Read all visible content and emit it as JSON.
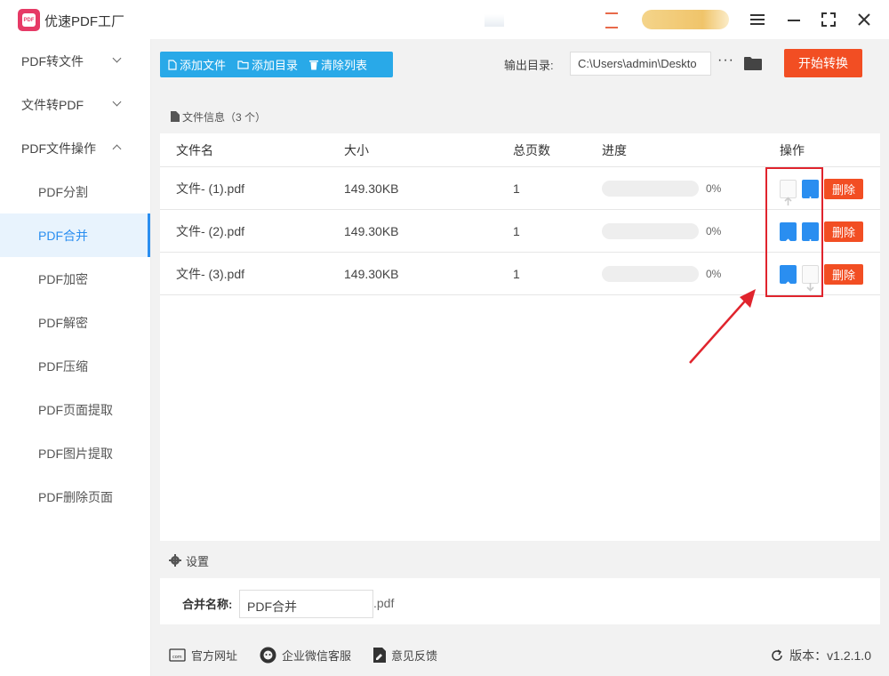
{
  "app": {
    "title": "优速PDF工厂",
    "logo_text": "PDF"
  },
  "sidebar": {
    "groups": [
      {
        "label": "PDF转文件",
        "expanded": false
      },
      {
        "label": "文件转PDF",
        "expanded": false
      },
      {
        "label": "PDF文件操作",
        "expanded": true
      }
    ],
    "items": [
      "PDF分割",
      "PDF合并",
      "PDF加密",
      "PDF解密",
      "PDF压缩",
      "PDF页面提取",
      "PDF图片提取",
      "PDF删除页面"
    ],
    "active_item": "PDF合并"
  },
  "toolbar": {
    "add_file": "添加文件",
    "add_dir": "添加目录",
    "clear_list": "清除列表",
    "output_label": "输出目录:",
    "output_path": "C:\\Users\\admin\\Deskto",
    "more": "···",
    "start": "开始转换"
  },
  "file_panel": {
    "title": "文件信息（3 个）",
    "columns": [
      "文件名",
      "大小",
      "总页数",
      "进度",
      "操作"
    ],
    "rows": [
      {
        "name": "文件- (1).pdf",
        "size": "149.30KB",
        "pages": "1",
        "progress_text": "0%",
        "progress": 0,
        "up_enabled": false,
        "down_enabled": true,
        "delete": "删除"
      },
      {
        "name": "文件- (2).pdf",
        "size": "149.30KB",
        "pages": "1",
        "progress_text": "0%",
        "progress": 0,
        "up_enabled": true,
        "down_enabled": true,
        "delete": "删除"
      },
      {
        "name": "文件- (3).pdf",
        "size": "149.30KB",
        "pages": "1",
        "progress_text": "0%",
        "progress": 0,
        "up_enabled": true,
        "down_enabled": false,
        "delete": "删除"
      }
    ]
  },
  "settings": {
    "title": "设置",
    "merge_label": "合并名称:",
    "merge_name": "PDF合并",
    "ext": ".pdf"
  },
  "footer": {
    "website": "官方网址",
    "wechat": "企业微信客服",
    "feedback": "意见反馈",
    "version_label": "版本：",
    "version": "v1.2.1.0"
  },
  "colors": {
    "accent": "#2a8ef0",
    "primary_action": "#f24e23",
    "toolbar": "#29a9e8",
    "highlight": "#e0242d",
    "logo": "#e63a66"
  },
  "icons": [
    "menu-icon",
    "minimize-icon",
    "maximize-icon",
    "close-icon",
    "file-icon",
    "folder-icon",
    "trash-icon",
    "up-arrow-icon",
    "down-arrow-icon",
    "gear-icon",
    "website-icon",
    "wechat-icon",
    "feedback-icon",
    "refresh-icon"
  ]
}
